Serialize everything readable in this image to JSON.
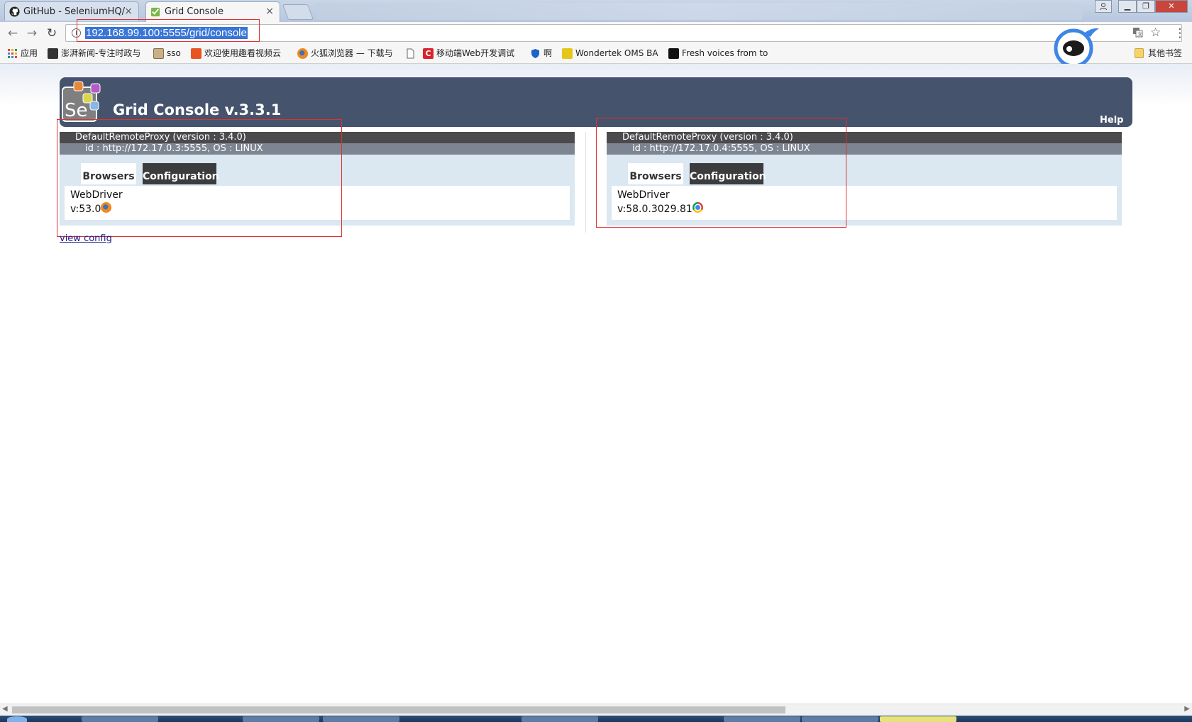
{
  "browser": {
    "tabs": [
      {
        "label": "GitHub - SeleniumHQ/",
        "icon": "github-icon",
        "close": "×"
      },
      {
        "label": "Grid Console",
        "icon": "grid-console-icon",
        "close": "×"
      }
    ],
    "url": "192.168.99.100:5555/grid/console",
    "info_icon": "i",
    "bookmarks": [
      {
        "label": "应用",
        "icon": "apps-icon",
        "color": "#e04a3a"
      },
      {
        "label": "澎湃新闻-专注时政与",
        "icon": "thepaper-icon",
        "color": "#333333"
      },
      {
        "label": "sso",
        "icon": "sso-icon",
        "color": "#8a6d3b"
      },
      {
        "label": "欢迎使用趣看视频云",
        "icon": "qukan-icon",
        "color": "#e8531f"
      },
      {
        "label": "火狐浏览器 — 下载与",
        "icon": "firefox-icon",
        "color": "#e66000"
      },
      {
        "label": "",
        "icon": "page-icon",
        "color": "#ffffff"
      },
      {
        "label": "移动端Web开发调试",
        "icon": "c-icon",
        "color": "#d9232d"
      },
      {
        "label": "啊",
        "icon": "shield-icon",
        "color": "#1e63c6"
      },
      {
        "label": "Wondertek OMS BA",
        "icon": "wondertek-icon",
        "color": "#e6c619"
      },
      {
        "label": "Fresh voices from to",
        "icon": "fresh-voices-icon",
        "color": "#111111"
      }
    ],
    "other_bookmarks": "其他书签"
  },
  "page": {
    "title": "Grid Console v.3.3.1",
    "help": "Help",
    "logo_text": "Se",
    "view_config": "view config",
    "proxies": [
      {
        "name": "DefaultRemoteProxy (version : 3.4.0)",
        "id_line": "id : http://172.17.0.3:5555, OS : LINUX",
        "tab_browsers": "Browsers",
        "tab_configuration": "Configuration",
        "protocol": "WebDriver",
        "version": "v:53.0",
        "browser_icon": "firefox-icon"
      },
      {
        "name": "DefaultRemoteProxy (version : 3.4.0)",
        "id_line": "id : http://172.17.0.4:5555, OS : LINUX",
        "tab_browsers": "Browsers",
        "tab_configuration": "Configuration",
        "protocol": "WebDriver",
        "version": "v:58.0.3029.81",
        "browser_icon": "chrome-icon"
      }
    ]
  },
  "colors": {
    "header_bg": "#46536d",
    "proxy_bg": "#dbe7f1",
    "annotation_red": "#e03030",
    "url_selection": "#3875d7"
  }
}
